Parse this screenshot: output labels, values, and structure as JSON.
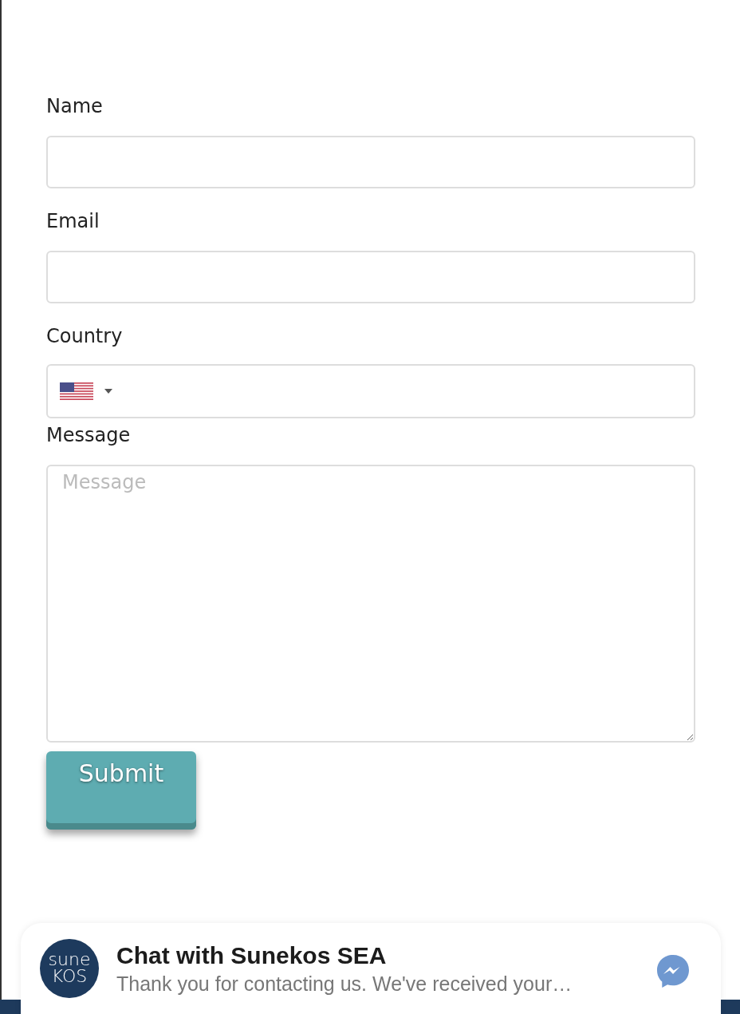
{
  "form": {
    "fields": [
      {
        "kind": "text",
        "label": "Name"
      },
      {
        "kind": "text",
        "label": "Email"
      },
      {
        "kind": "country",
        "label": "Country"
      },
      {
        "kind": "textarea",
        "label": "Message",
        "placeholder": "Message"
      }
    ],
    "submit": "Submit"
  },
  "chat_widget": {
    "logo_lines": [
      "sune",
      "KOS"
    ],
    "title": "Chat with Sunekos SEA",
    "preview": "Thank you for contacting us. We've received your…"
  }
}
